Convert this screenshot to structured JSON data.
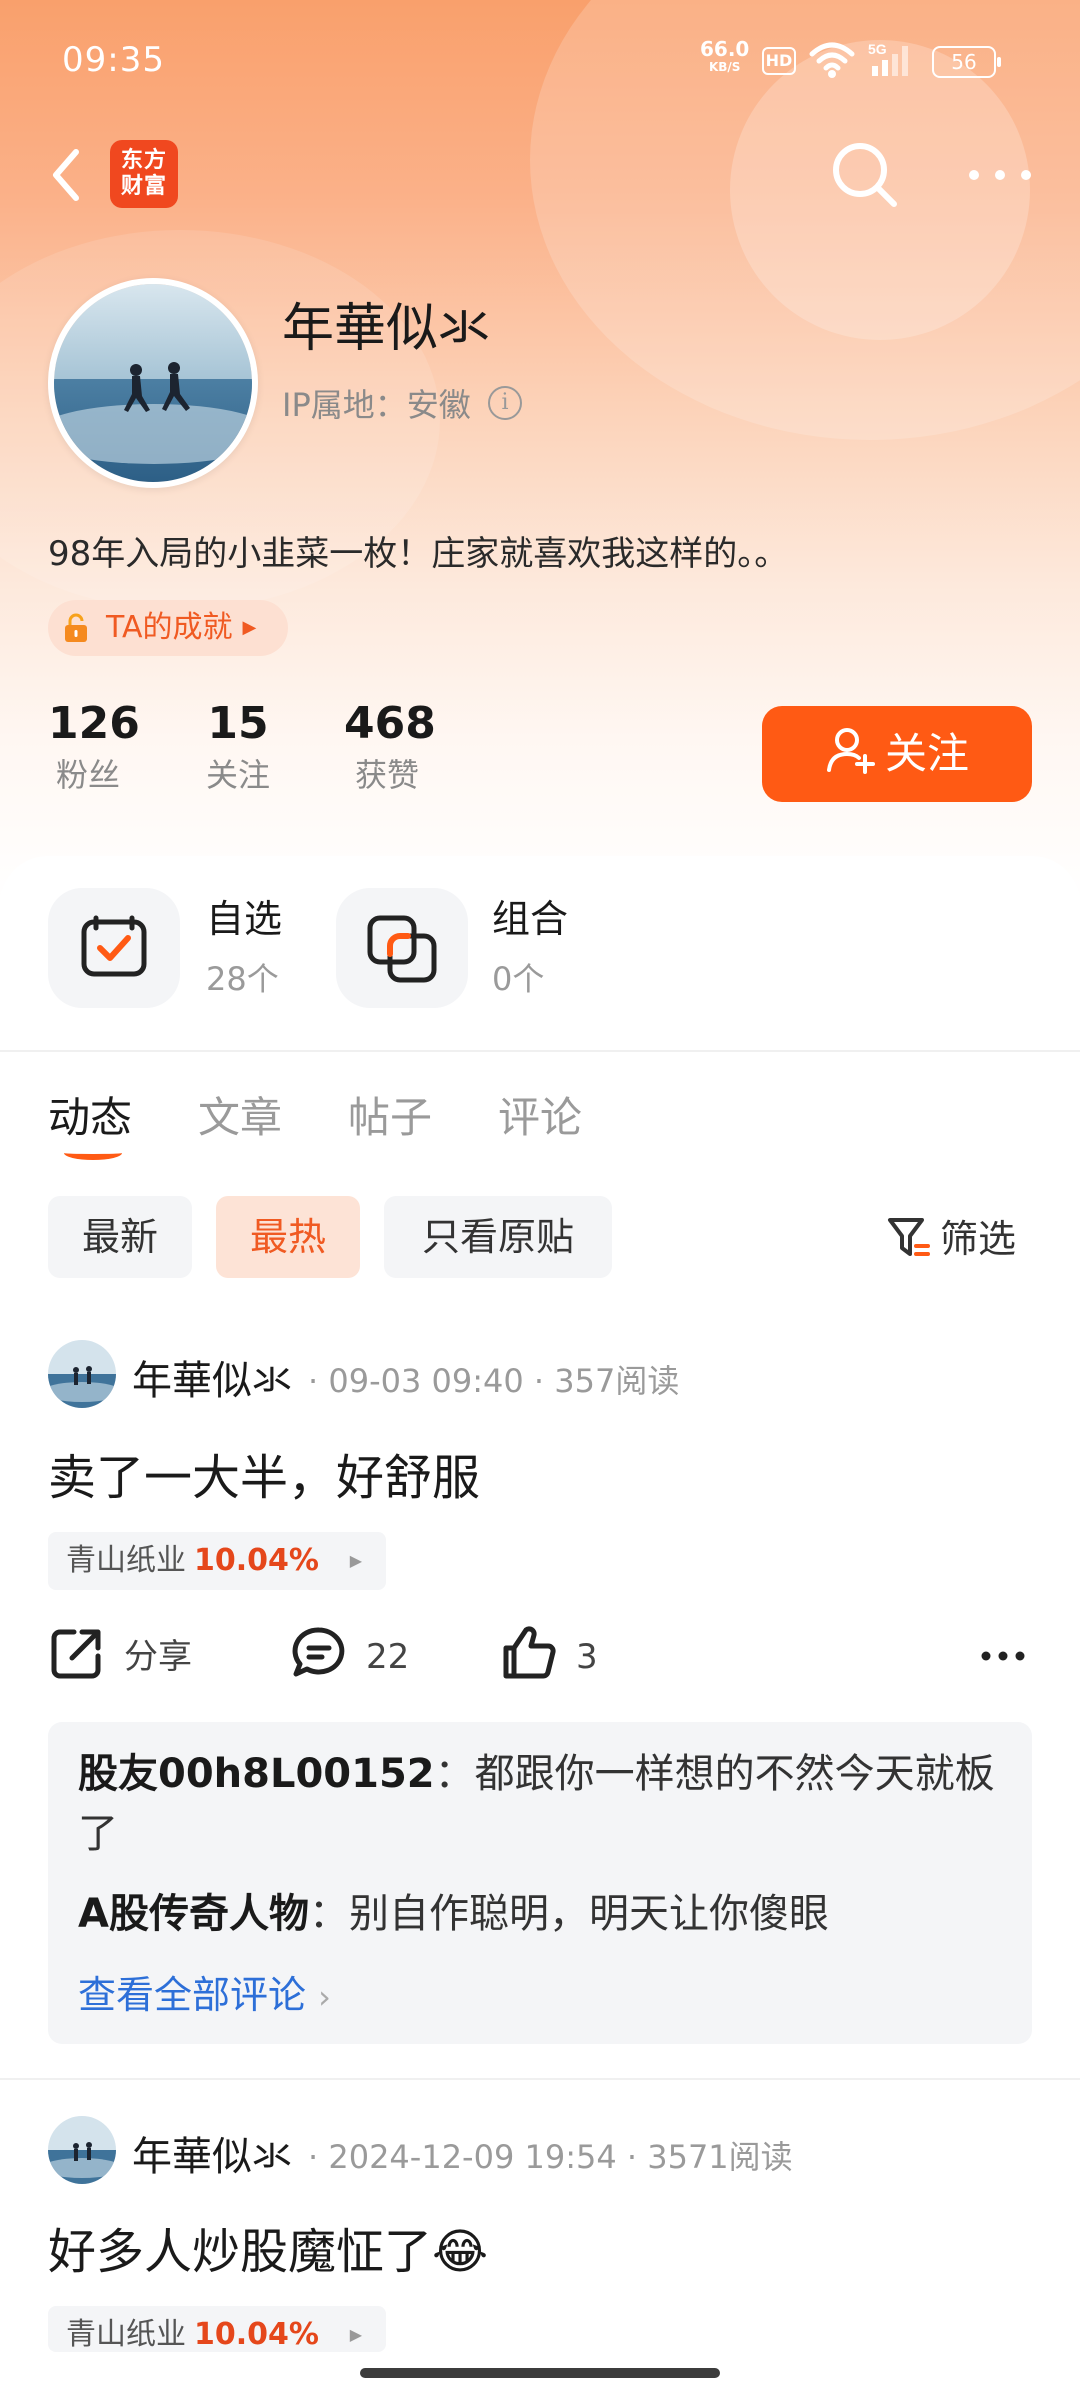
{
  "status_bar": {
    "time": "09:35",
    "net_speed": "66.0",
    "net_unit": "KB/S",
    "hd": "HD",
    "network": "5G",
    "battery": "56"
  },
  "header": {
    "logo_line1": "东方",
    "logo_line2": "财富"
  },
  "profile": {
    "name": "年華似氺",
    "ip_location": "IP属地：安徽",
    "bio": "98年入局的小韭菜一枚！庄家就喜欢我这样的。。",
    "achievement": "TA的成就",
    "stats": [
      {
        "value": "126",
        "label": "粉丝"
      },
      {
        "value": "15",
        "label": "关注"
      },
      {
        "value": "468",
        "label": "获赞"
      }
    ],
    "follow_label": "关注"
  },
  "shortcuts": [
    {
      "title": "自选",
      "count": "28个"
    },
    {
      "title": "组合",
      "count": "0个"
    }
  ],
  "tabs": [
    {
      "label": "动态"
    },
    {
      "label": "文章"
    },
    {
      "label": "帖子"
    },
    {
      "label": "评论"
    }
  ],
  "chips": [
    {
      "label": "最新"
    },
    {
      "label": "最热"
    },
    {
      "label": "只看原贴"
    }
  ],
  "filter_label": "筛选",
  "posts": [
    {
      "author": "年華似氺",
      "meta": "· 09-03 09:40 · 357阅读",
      "text": "卖了一大半，好舒服",
      "stock_name": "青山纸业",
      "stock_change": "10.04%",
      "share_label": "分享",
      "comment_count": "22",
      "like_count": "3",
      "comments": [
        {
          "user": "股友00h8L00152",
          "sep": "：",
          "text": "都跟你一样想的不然今天就板了"
        },
        {
          "user": "A股传奇人物",
          "sep": "：",
          "text": "别自作聪明，明天让你傻眼"
        }
      ],
      "view_all_label": "查看全部评论"
    },
    {
      "author": "年華似氺",
      "meta": "· 2024-12-09 19:54 · 3571阅读",
      "text": "好多人炒股魔怔了",
      "emoji": "😂",
      "stock_name": "青山纸业",
      "stock_change": "10.04%"
    }
  ],
  "colors": {
    "accent": "#ff5a14",
    "accent_text": "#f05a22",
    "link": "#2d6fd8",
    "stock_up": "#e5471b"
  },
  "icons": [
    "back-arrow-icon",
    "search-icon",
    "more-icon",
    "info-icon",
    "lock-icon",
    "user-plus-icon",
    "watchlist-icon",
    "portfolio-icon",
    "filter-icon",
    "share-icon",
    "comment-icon",
    "like-icon",
    "more-dots-icon",
    "chevron-right-icon"
  ]
}
